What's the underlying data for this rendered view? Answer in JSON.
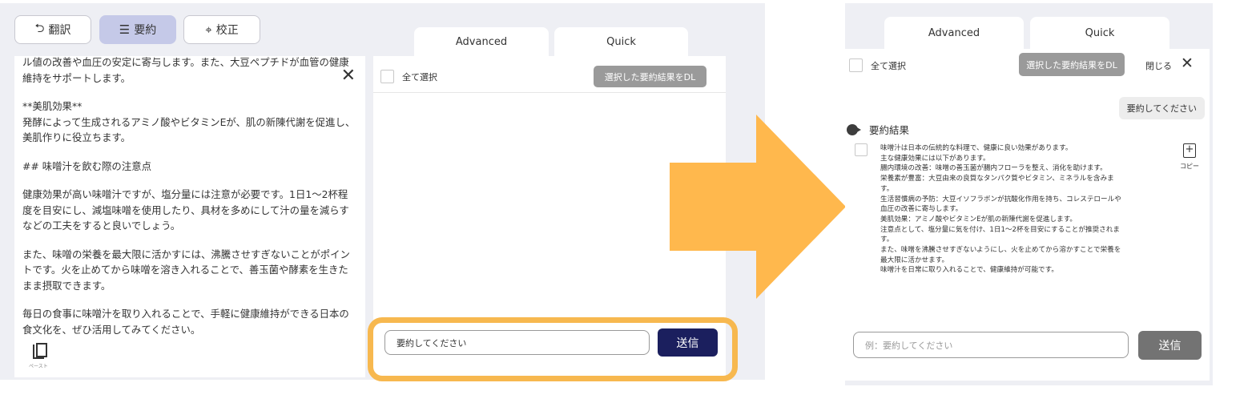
{
  "left": {
    "modes": [
      {
        "label": "翻訳",
        "icon": "translate-icon",
        "glyph": "⮌"
      },
      {
        "label": "要約",
        "icon": "summary-icon",
        "glyph": "☰"
      },
      {
        "label": "校正",
        "icon": "crosshair-icon",
        "glyph": "⌖"
      }
    ],
    "paragraphs": [
      "ル値の改善や血圧の安定に寄与します。また、大豆ペプチドが血管の健康維持をサポートします。",
      "**美肌効果**\n発酵によって生成されるアミノ酸やビタミンEが、肌の新陳代謝を促進し、美肌作りに役立ちます。",
      "## 味噌汁を飲む際の注意点",
      "健康効果が高い味噌汁ですが、塩分量には注意が必要です。1日1〜2杯程度を目安にし、減塩味噌を使用したり、具材を多めにして汁の量を減らすなどの工夫をすると良いでしょう。",
      "また、味噌の栄養を最大限に活かすには、沸騰させすぎないことがポイントです。火を止めてから味噌を溶き入れることで、善玉菌や酵素を生きたまま摂取できます。",
      "毎日の食事に味噌汁を取り入れることで、手軽に健康維持ができる日本の食文化を、ぜひ活用してみてください。"
    ],
    "close_glyph": "✕",
    "paste_label": "ペースト",
    "tabs": [
      "Advanced",
      "Quick"
    ],
    "select_all": "全て選択",
    "dl_button": "選択した要約結果をDL",
    "input_value": "要約してください",
    "send_label": "送信",
    "send_color": "#1b1f5e",
    "highlight_color": "#f7b84f"
  },
  "arrow_color": "#ffb84d",
  "right": {
    "tabs": [
      "Advanced",
      "Quick"
    ],
    "select_all": "全て選択",
    "dl_button": "選択した要約結果をDL",
    "close_label": "閉じる",
    "close_glyph": "✕",
    "request_bubble": "要約してください",
    "result_title": "要約結果",
    "result_lines": [
      "味噌汁は日本の伝統的な料理で、健康に良い効果があります。",
      "主な健康効果には以下があります。",
      "腸内環境の改善：味噌の善玉菌が腸内フローラを整え、消化を助けます。",
      "栄養素が豊富：大豆由来の良質なタンパク質やビタミン、ミネラルを含みま",
      "す。",
      "生活習慣病の予防：大豆イソフラボンが抗酸化作用を持ち、コレステロールや",
      "血圧の改善に寄与します。",
      "美肌効果：アミノ酸やビタミンEが肌の新陳代謝を促進します。",
      "注意点として、塩分量に気を付け、1日1〜2杯を目安にすることが推奨されま",
      "す。",
      "また、味噌を沸騰させすぎないようにし、火を止めてから溶かすことで栄養を",
      "最大限に活かせます。",
      "味噌汁を日常に取り入れることで、健康維持が可能です。"
    ],
    "copy_label": "コピー",
    "input_placeholder": "例：要約してください",
    "send_label": "送信",
    "send_color": "#737373"
  }
}
